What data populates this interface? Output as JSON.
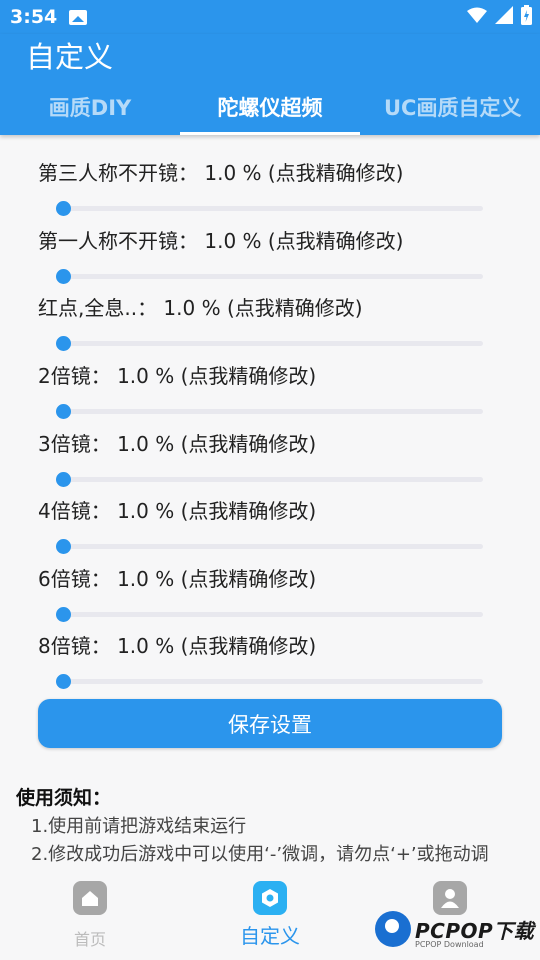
{
  "status_bar": {
    "time": "3:54"
  },
  "header": {
    "title": "自定义",
    "tabs": [
      {
        "label": "画质DIY"
      },
      {
        "label": "陀螺仪超频"
      },
      {
        "label": "UC画质自定义"
      }
    ],
    "active_tab": 1
  },
  "settings": [
    {
      "label": "第三人称不开镜： 1.0 %  (点我精确修改)",
      "value": 1.0
    },
    {
      "label": "第一人称不开镜： 1.0 %  (点我精确修改)",
      "value": 1.0
    },
    {
      "label": "红点,全息..： 1.0 %  (点我精确修改)",
      "value": 1.0
    },
    {
      "label": "2倍镜： 1.0 %  (点我精确修改)",
      "value": 1.0
    },
    {
      "label": "3倍镜： 1.0 %  (点我精确修改)",
      "value": 1.0
    },
    {
      "label": "4倍镜： 1.0 %  (点我精确修改)",
      "value": 1.0
    },
    {
      "label": "6倍镜： 1.0 %  (点我精确修改)",
      "value": 1.0
    },
    {
      "label": "8倍镜： 1.0 %  (点我精确修改)",
      "value": 1.0
    }
  ],
  "save_button_label": "保存设置",
  "notice": {
    "title": "使用须知：",
    "lines": [
      "1.使用前请把游戏结束运行",
      "2.修改成功后游戏中可以使用‘-’微调，请勿点‘+’或拖动调"
    ]
  },
  "bottom_nav": [
    {
      "label": "首页",
      "icon": "home-icon"
    },
    {
      "label": "自定义",
      "icon": "custom-icon"
    },
    {
      "label": "",
      "icon": "profile-icon"
    }
  ],
  "watermark": {
    "text": "PCPOP下载",
    "sub": "PCPOP Download"
  },
  "colors": {
    "primary": "#2b95ec",
    "nav_active_icon": "#2bb0f2",
    "background": "#f7f7f8"
  }
}
